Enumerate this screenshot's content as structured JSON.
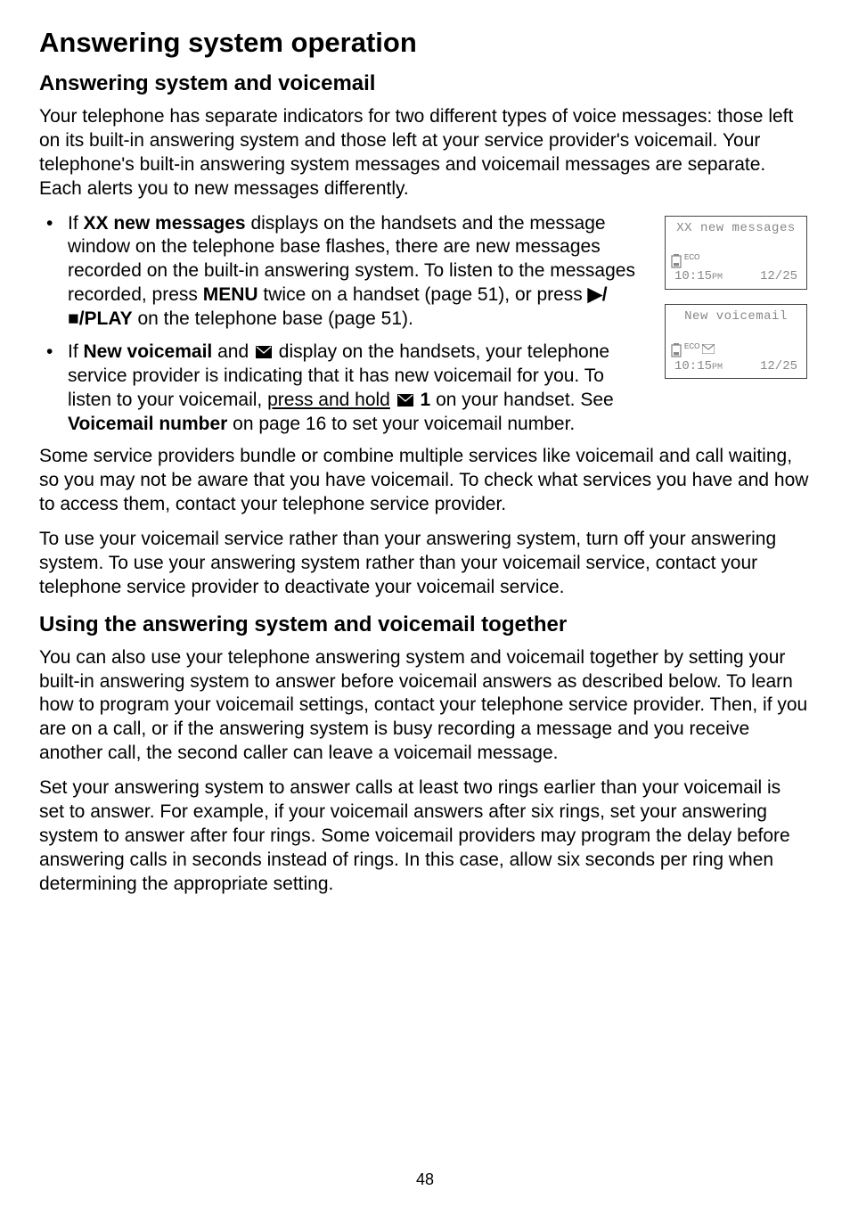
{
  "title": "Answering system operation",
  "section1": {
    "heading": "Answering system and voicemail",
    "intro": "Your telephone has separate indicators for two different types of voice messages: those left on its built-in answering system and those left at your service provider's voicemail. Your telephone's built-in answering system messages and voicemail messages are separate. Each alerts you to new messages differently.",
    "bullet1": {
      "pre": "If ",
      "bold1": "XX new messages",
      "mid1": " displays on the handsets and the message window on the telephone base flashes, there are new messages recorded on the built-in answering system. To listen to the messages recorded, press ",
      "bold2": "MENU",
      "mid2_a": " twice on a handset (page 51), or press ",
      "boldplay": "/PLAY",
      "mid2_b": " on the telephone base (page 51)."
    },
    "bullet2": {
      "pre": "If ",
      "bold1": "New voicemail",
      "mid1": " and ",
      "mid2": " display on the handsets, your telephone service provider is indicating that it has new voicemail for you. To listen to your voicemail, ",
      "underlined": "press and hold",
      "mid3_a": " ",
      "key1": "1",
      "mid3_b": " on your handset. See ",
      "bold2": "Voicemail number",
      "mid4": " on page 16 to set your voicemail number."
    },
    "para2": "Some service providers bundle or combine multiple services like voicemail and call waiting, so you may not be aware that you have voicemail. To check what services you have and how to access them, contact your telephone service provider.",
    "para3": "To use your voicemail service rather than your answering system, turn off your answering system. To use your answering system rather than your voicemail service, contact your telephone service provider to deactivate your voicemail service."
  },
  "section2": {
    "heading": "Using the answering system and voicemail together",
    "para1": "You can also use your telephone answering system and voicemail together by setting your built-in answering system to answer before voicemail answers as described below. To learn how to program your voicemail settings, contact your telephone service provider. Then, if you are on a call, or if the answering system is busy recording a message and you receive another call, the second caller can leave a voicemail message.",
    "para2": "Set your answering system to answer calls at least two rings earlier than your voicemail is set to answer. For example, if your voicemail answers after six rings, set your answering system to answer after four rings. Some voicemail providers may program the delay before answering calls in seconds instead of rings. In this case, allow six seconds per ring when determining the appropriate setting."
  },
  "screens": {
    "s1": {
      "top": "XX new messages",
      "eco": "ECO",
      "time": "10:15",
      "ampm": "PM",
      "date": "12/25"
    },
    "s2": {
      "top": "New voicemail",
      "eco": "ECO",
      "time": "10:15",
      "ampm": "PM",
      "date": "12/25"
    }
  },
  "pagenum": "48",
  "chart_data": null
}
